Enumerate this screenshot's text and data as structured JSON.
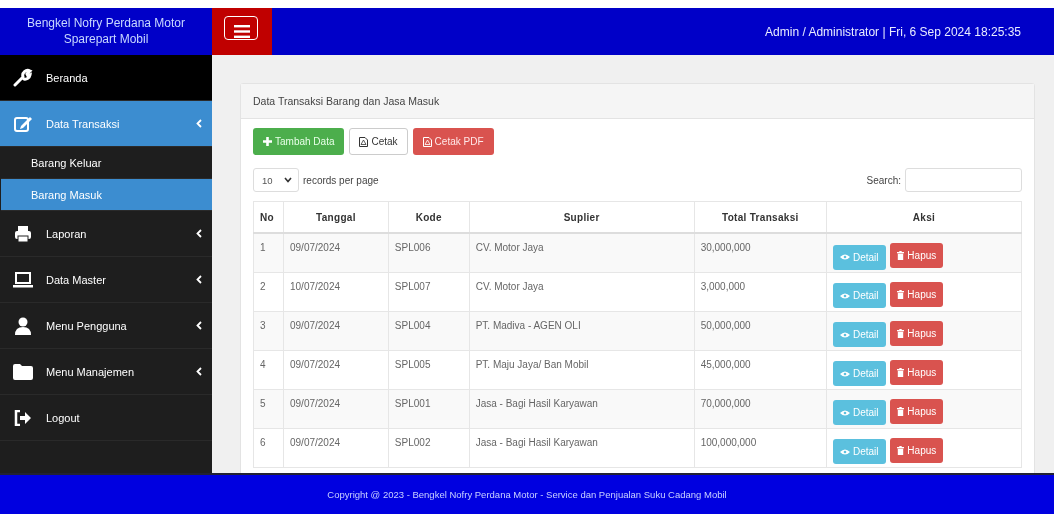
{
  "header": {
    "brand": "Bengkel Nofry Perdana Motor Sparepart Mobil",
    "user_info": "Admin / Administrator | Fri, 6 Sep 2024 18:25:35"
  },
  "sidebar": {
    "items": [
      {
        "label": "Beranda",
        "selected": false,
        "submenu": false
      },
      {
        "label": "Data Transaksi",
        "selected": true,
        "submenu": true,
        "expanded": true,
        "children": [
          {
            "label": "Barang Keluar",
            "selected": false
          },
          {
            "label": "Barang Masuk",
            "selected": true
          }
        ]
      },
      {
        "label": "Laporan",
        "selected": false,
        "submenu": true
      },
      {
        "label": "Data Master",
        "selected": false,
        "submenu": true
      },
      {
        "label": "Menu Pengguna",
        "selected": false,
        "submenu": true
      },
      {
        "label": "Menu Manajemen",
        "selected": false,
        "submenu": true
      },
      {
        "label": "Logout",
        "selected": false,
        "submenu": false
      }
    ]
  },
  "panel": {
    "title": "Data Transaksi Barang dan Jasa Masuk",
    "buttons": [
      {
        "kind": "add",
        "label": "Tambah Data"
      },
      {
        "kind": "print",
        "label": "Cetak"
      },
      {
        "kind": "pdf",
        "label": "Cetak PDF"
      }
    ],
    "page_size": "10",
    "page_size_label": "records per page",
    "search_label": "Search:",
    "table": {
      "columns": [
        "No",
        "Tanggal",
        "Kode",
        "Suplier",
        "Total Transaksi",
        "Aksi"
      ],
      "rows": [
        {
          "no": "1",
          "tanggal": "09/07/2024",
          "kode": "SPL006",
          "suplier": "CV. Motor Jaya",
          "total": "30,000,000",
          "actions": [
            "Detail",
            "Hapus"
          ]
        },
        {
          "no": "2",
          "tanggal": "10/07/2024",
          "kode": "SPL007",
          "suplier": "CV. Motor Jaya",
          "total": "3,000,000",
          "actions": [
            "Detail",
            "Hapus"
          ]
        },
        {
          "no": "3",
          "tanggal": "09/07/2024",
          "kode": "SPL004",
          "suplier": "PT. Madiva - AGEN OLI",
          "total": "50,000,000",
          "actions": [
            "Detail",
            "Hapus"
          ]
        },
        {
          "no": "4",
          "tanggal": "09/07/2024",
          "kode": "SPL005",
          "suplier": "PT. Maju Jaya/ Ban Mobil",
          "total": "45,000,000",
          "actions": [
            "Detail",
            "Hapus"
          ]
        },
        {
          "no": "5",
          "tanggal": "09/07/2024",
          "kode": "SPL001",
          "suplier": "Jasa - Bagi Hasil Karyawan",
          "total": "70,000,000",
          "actions": [
            "Detail",
            "Hapus"
          ]
        },
        {
          "no": "6",
          "tanggal": "09/07/2024",
          "kode": "SPL002",
          "suplier": "Jasa - Bagi Hasil Karyawan",
          "total": "100,000,000",
          "actions": [
            "Detail",
            "Hapus"
          ]
        }
      ]
    }
  },
  "footer": {
    "text": "Copyright @ 2023 - Bengkel Nofry Perdana Motor - Service dan Penjualan Suku Cadang Mobil"
  }
}
